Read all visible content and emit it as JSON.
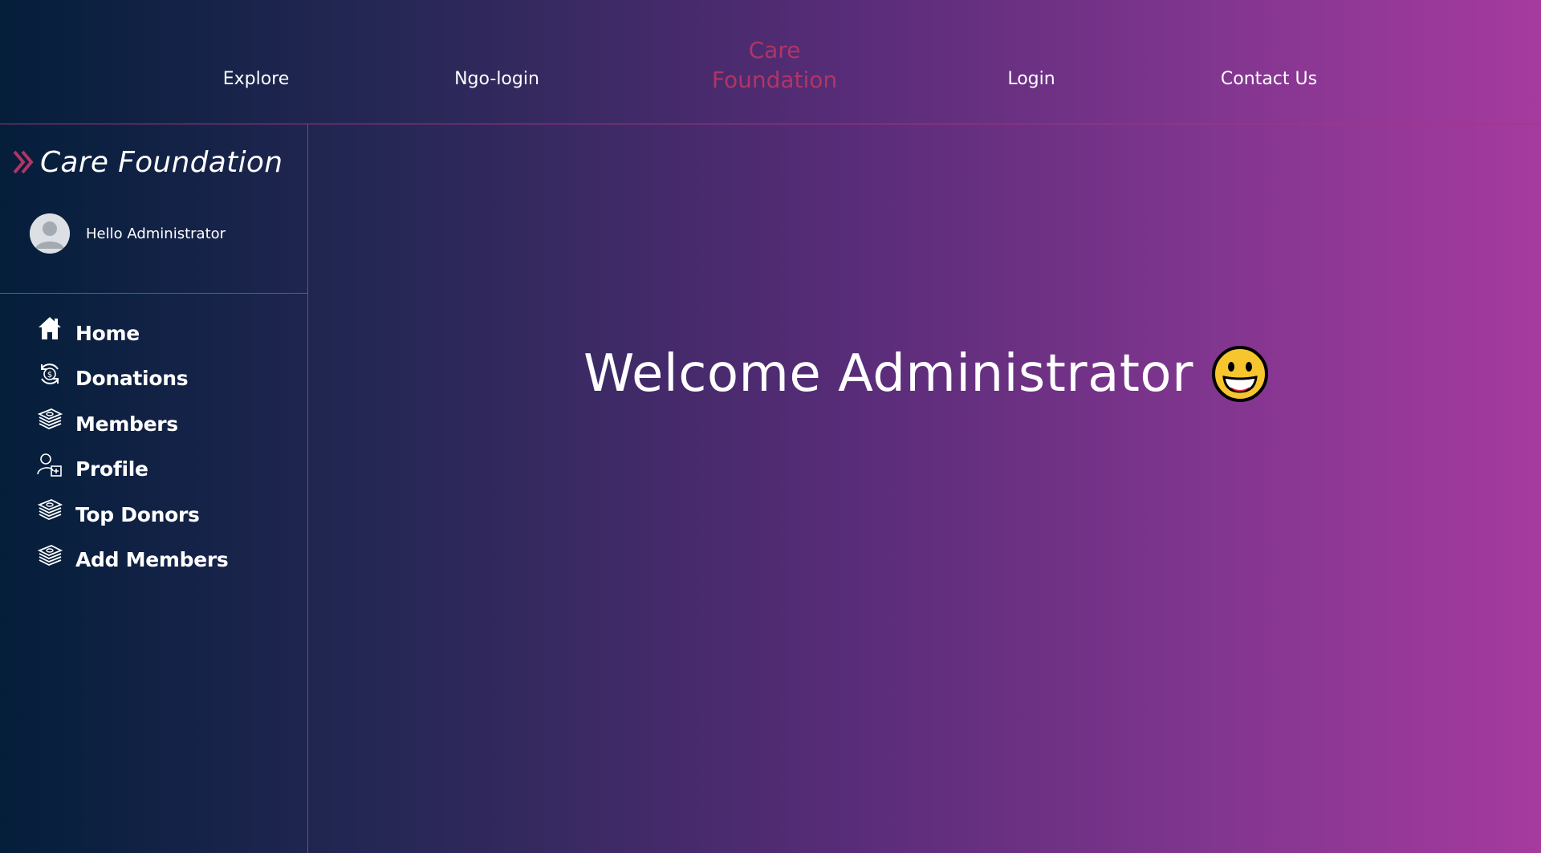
{
  "topnav": {
    "links": [
      {
        "label": "Explore"
      },
      {
        "label": "Ngo-login"
      },
      {
        "label": "Login"
      },
      {
        "label": "Contact Us"
      }
    ],
    "brand_line1": "Care",
    "brand_line2": "Foundation"
  },
  "sidebar": {
    "brand": "Care Foundation",
    "brand_icon": "double-chevron-right-icon",
    "greeting": "Hello Administrator",
    "avatar_icon": "user-avatar-icon",
    "items": [
      {
        "label": "Home",
        "icon": "home-icon"
      },
      {
        "label": "Donations",
        "icon": "dollar-cycle-icon"
      },
      {
        "label": "Members",
        "icon": "money-stack-icon"
      },
      {
        "label": "Profile",
        "icon": "user-add-icon"
      },
      {
        "label": "Top Donors",
        "icon": "money-stack-icon"
      },
      {
        "label": "Add Members",
        "icon": "money-stack-icon"
      }
    ]
  },
  "main": {
    "welcome": "Welcome Administrator",
    "emoji_icon": "grinning-face-icon"
  },
  "colors": {
    "accent": "#b03565",
    "divider": "#a8347e",
    "gradient_start": "#041e3a",
    "gradient_end": "#a63a9f"
  }
}
